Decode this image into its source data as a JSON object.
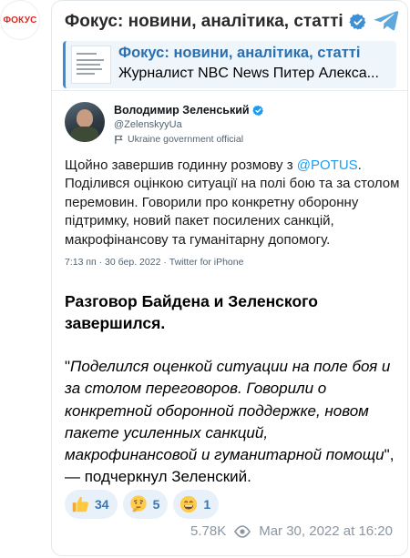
{
  "channel": {
    "avatar_text": "ФОКУС",
    "title": "Фокус: новини, аналітика, статті",
    "brand_color": "#e1251b",
    "accent_color": "#2b6fae"
  },
  "reply": {
    "title": "Фокус: новини, аналітика, статті",
    "text": "Журналист NBC News Питер Алекса..."
  },
  "tweet": {
    "author_name": "Володимир Зеленський",
    "handle": "@ZelenskyyUa",
    "gov_label": "Ukraine government official",
    "text_before": "Щойно завершив годинну розмову з ",
    "mention": "@POTUS",
    "text_after": ". Поділився оцінкою ситуації на полі бою та за столом перемовин. Говорили про конкретну оборонну підтримку, новий пакет посилених санкцій, макрофінансову та гуманітарну допомогу.",
    "meta": "7:13 пп · 30 бер. 2022 · Twitter for iPhone"
  },
  "post": {
    "headline": "Разговор Байдена и Зеленского завершился.",
    "quote_open": "\"",
    "quote_italic": "Поделился оценкой ситуации на поле боя и за столом переговоров. Говорили о конкретной оборонной поддержке, новом пакете усиленных санкций, макрофинансовой и гуманитарной помощи",
    "quote_tail": "\", — подчеркнул Зеленский."
  },
  "reactions": [
    {
      "emoji": "thumbs-up",
      "count": "34"
    },
    {
      "emoji": "thinking-face",
      "count": "5"
    },
    {
      "emoji": "grinning-face",
      "count": "1"
    }
  ],
  "footer": {
    "views": "5.78K",
    "datetime": "Mar 30, 2022 at 16:20"
  }
}
